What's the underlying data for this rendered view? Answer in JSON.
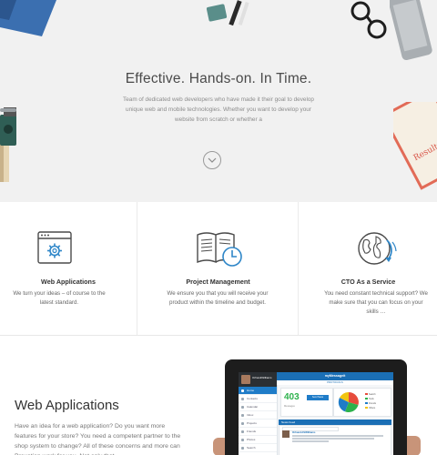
{
  "hero": {
    "title": "Effective. Hands-on. In Time.",
    "lead": "Team of dedicated web developers who have made it their goal to develop unique web and mobile technologies. Whether you want to develop your website from scratch or whether a",
    "scroll_icon": "chevron-down-icon",
    "book_text": "Results Jose"
  },
  "services": [
    {
      "icon": "browser-gear-icon",
      "title": "Web Applications",
      "desc": "We turn your ideas – of course to the latest standard."
    },
    {
      "icon": "book-clock-icon",
      "title": "Project Management",
      "desc": "We ensure you that you will receive your product within the timeline and budget."
    },
    {
      "icon": "globe-refresh-icon",
      "title": "CTO As a Service",
      "desc": "You need constant technical support? We make sure that you can focus on your skills …"
    }
  ],
  "webapps": {
    "title": "Web Applications",
    "text": "Have an idea for a web application? Do you want more features for your store? You need a competent partner to the shop system to change? All of these concerns and more can Proxation work for you. Not only that,"
  },
  "tablet_app": {
    "user_name": "Orhan&Williams",
    "header": "myMessageit",
    "subheader": "PROTOCOLS",
    "stat_value": "403",
    "stat_label": "Messages",
    "stat_button": "Send News",
    "nav": [
      "Home",
      "Contacts",
      "Calendar",
      "Inbox",
      "Projects",
      "Friends",
      "Photos",
      "Search"
    ],
    "feed_title": "News Feed",
    "feed_author": "OrhanAASWilliams",
    "legend": [
      "Search",
      "Tools",
      "Friends",
      "Others"
    ],
    "colors": {
      "primary": "#1b6fb5",
      "green": "#2db24c",
      "pie": [
        "#e74c3c",
        "#2db24c",
        "#1f7cc8",
        "#f1c40f"
      ]
    }
  }
}
